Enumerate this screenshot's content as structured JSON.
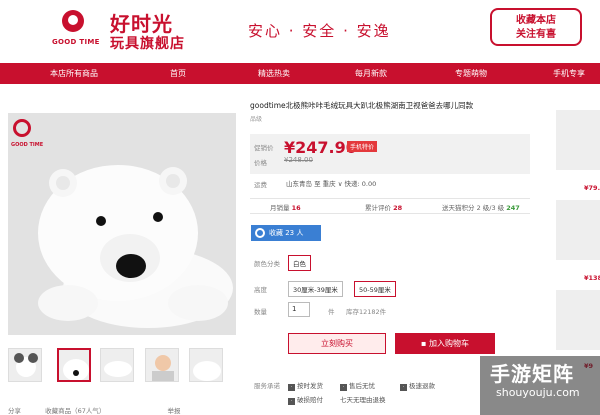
{
  "header": {
    "logo_en": "GOOD TIME",
    "logo_cn_line1": "好时光",
    "logo_cn_line2": "玩具旗舰店",
    "slogan": "安心 · 安全 · 安逸",
    "fav_line1": "收藏本店",
    "fav_line2": "关注有喜"
  },
  "nav": {
    "items": [
      "本店所有商品",
      "首页",
      "精选热卖",
      "每月新款",
      "专题萌物",
      "手机专享"
    ]
  },
  "gallery": {
    "logo_en": "GOOD TIME"
  },
  "product": {
    "title": "goodtime北极熊咔咔毛绒玩具大趴北极熊湖南卫视爸爸去哪儿同款",
    "subtitle": "品级",
    "promo_label": "促销价",
    "price": "¥247.90",
    "price_badge": "手机特价",
    "orig_label": "价格",
    "orig_price": "¥248.00",
    "delivery_label": "运费",
    "delivery": "山东青岛 至 重庆 ∨ 快递: 0.00",
    "monthly_label": "月销量",
    "monthly_value": "16",
    "reviews_label": "累计评价",
    "reviews_value": "28",
    "points_label": "送天猫积分",
    "points_mid": "2 级/3 级",
    "points_value": "247",
    "collect": "收藏 23 人",
    "color_label": "颜色分类",
    "color_value": "白色",
    "size_label": "高度",
    "sizes": [
      "30厘米-39厘米",
      "50-59厘米"
    ],
    "qty_label": "数量",
    "qty": "1",
    "qty_unit": "件",
    "stock": "库存12182件",
    "buy": "立刻购买",
    "cart": "加入购物车",
    "service_label": "服务承诺",
    "services": [
      "按时发货",
      "售后无忧",
      "极速退款",
      "破损赔付",
      "七天无理由退换"
    ]
  },
  "bottom": {
    "share": "分享",
    "fav": "收藏商品（67人气）",
    "report": "举报"
  },
  "side": {
    "prices": [
      "¥79.",
      "¥138",
      "¥9"
    ]
  },
  "watermark": {
    "cn": "手游矩阵",
    "en": "shouyouju.com"
  },
  "colors": {
    "brand": "#c8102e",
    "collect_blue": "#3a7fd3"
  }
}
